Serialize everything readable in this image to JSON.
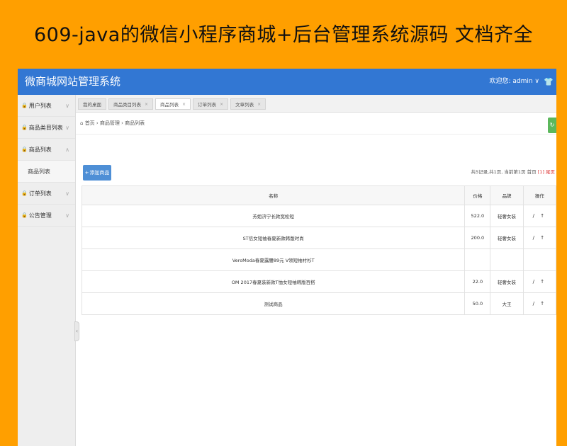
{
  "banner": {
    "title": "609-java的微信小程序商城+后台管理系统源码 文档齐全"
  },
  "header": {
    "app_title": "微商城网站管理系统",
    "user_label": "欢迎您: admin ∨",
    "shirt_icon": "👕"
  },
  "sidebar": {
    "items": [
      {
        "label": "用户列表"
      },
      {
        "label": "商品类目列表"
      },
      {
        "label": "商品列表",
        "expanded": true,
        "children": [
          {
            "label": "商品列表"
          }
        ]
      },
      {
        "label": "订单列表"
      },
      {
        "label": "公告管理"
      }
    ]
  },
  "tabs": [
    {
      "label": "我的桌面",
      "closable": false
    },
    {
      "label": "商品类目列表",
      "closable": true
    },
    {
      "label": "商品列表",
      "closable": true,
      "active": true
    },
    {
      "label": "订单列表",
      "closable": true
    },
    {
      "label": "文章列表",
      "closable": true
    }
  ],
  "breadcrumb": {
    "text": "首页 › 商品管理 › 商品列表"
  },
  "toolbar": {
    "add_label": "添加商品",
    "page_info": "共5记录,共1页, 当前第1页 首页",
    "current_page": "[1]",
    "last_page": "尾页"
  },
  "table": {
    "headers": {
      "name": "名称",
      "price": "价格",
      "brand": "品牌",
      "ops": "操作"
    },
    "rows": [
      {
        "name": "芳姐济宁长款宽松短",
        "price": "522.0",
        "brand": "轻奢女装",
        "ops": "/ ↑"
      },
      {
        "name": "ST信女短袖春夏新款韩版时尚",
        "price": "200.0",
        "brand": "轻奢女装",
        "ops": "/ ↑"
      },
      {
        "name": "VeroModa春夏露腰89元 V领短袖衬衫T",
        "price": "",
        "brand": "",
        "ops": ""
      },
      {
        "name": "OM 2017春夏装新款T恤女短袖韩版百搭",
        "price": "22.0",
        "brand": "轻奢女装",
        "ops": "/ ↑"
      },
      {
        "name": "测试商品",
        "price": "50.0",
        "brand": "大王",
        "ops": "/ ↑"
      }
    ]
  },
  "colors": {
    "background": "#FF9F00",
    "header": "#3277D3",
    "add_button": "#4E8FD6",
    "refresh_button": "#5CB85C"
  }
}
